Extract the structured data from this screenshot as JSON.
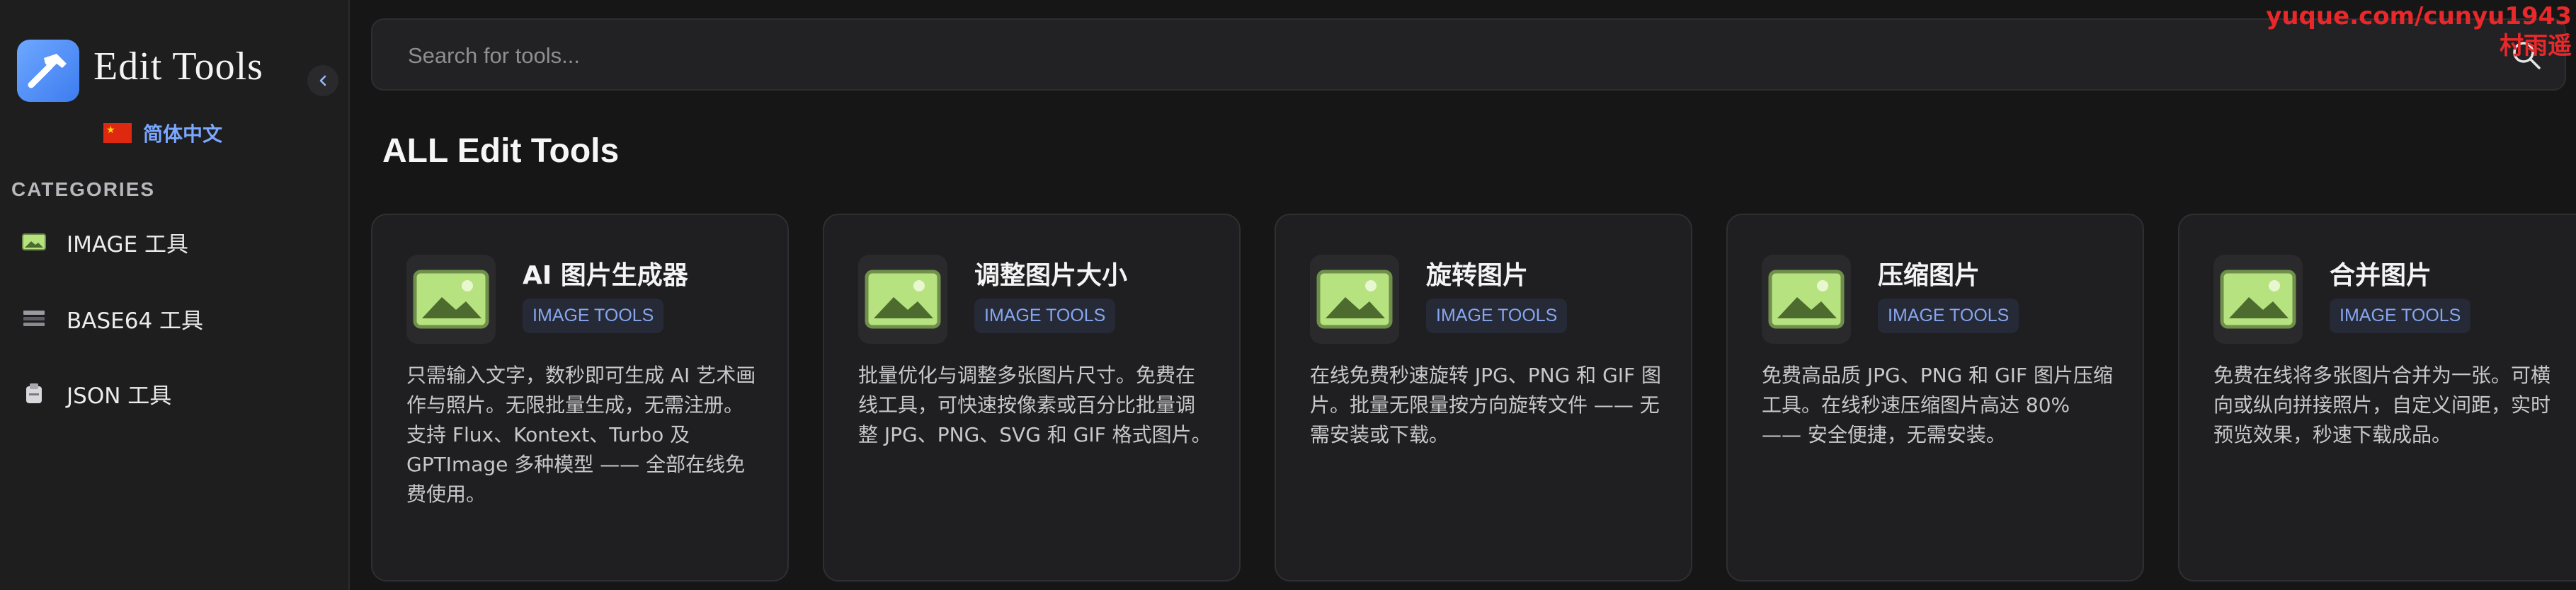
{
  "app": {
    "brand": "Edit Tools",
    "language": "简体中文"
  },
  "sidebar": {
    "heading": "CATEGORIES",
    "items": [
      {
        "label": "IMAGE 工具",
        "icon": "image-icon"
      },
      {
        "label": "BASE64 工具",
        "icon": "code-icon"
      },
      {
        "label": "JSON 工具",
        "icon": "document-icon"
      }
    ]
  },
  "search": {
    "placeholder": "Search for tools..."
  },
  "watermark": {
    "line1": "yuque.com/cunyu1943",
    "line2": "村雨遥"
  },
  "main": {
    "title": "ALL Edit Tools",
    "cards": [
      {
        "title": "AI 图片生成器",
        "badge": "IMAGE TOOLS",
        "description": "只需输入文字，数秒即可生成 AI 艺术画作与照片。无限批量生成，无需注册。支持 Flux、Kontext、Turbo 及 GPTImage 多种模型 —— 全部在线免费使用。"
      },
      {
        "title": "调整图片大小",
        "badge": "IMAGE TOOLS",
        "description": "批量优化与调整多张图片尺寸。免费在线工具，可快速按像素或百分比批量调整 JPG、PNG、SVG 和 GIF 格式图片。"
      },
      {
        "title": "旋转图片",
        "badge": "IMAGE TOOLS",
        "description": "在线免费秒速旋转 JPG、PNG 和 GIF 图片。批量无限量按方向旋转文件 —— 无需安装或下载。"
      },
      {
        "title": "压缩图片",
        "badge": "IMAGE TOOLS",
        "description": "免费高品质 JPG、PNG 和 GIF 图片压缩工具。在线秒速压缩图片高达 80% —— 安全便捷，无需安装。"
      },
      {
        "title": "合并图片",
        "badge": "IMAGE TOOLS",
        "description": "免费在线将多张图片合并为一张。可横向或纵向拼接照片，自定义间距，实时预览效果，秒速下载成品。"
      }
    ]
  },
  "colors": {
    "background": "#161616",
    "card": "#1f1f21",
    "accent": "#7aa7ff",
    "badge_text": "#86a6f0",
    "image_icon_fill": "#b6e27f",
    "watermark": "#e8282a"
  }
}
